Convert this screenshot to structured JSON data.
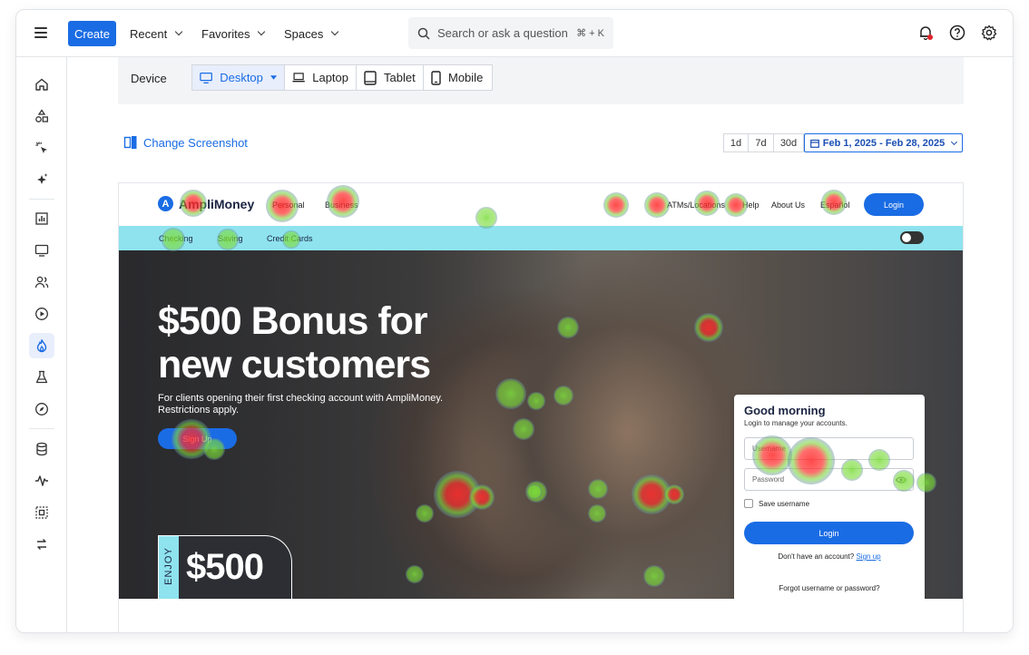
{
  "topbar": {
    "create_label": "Create",
    "recent_label": "Recent",
    "favorites_label": "Favorites",
    "spaces_label": "Spaces",
    "search_placeholder": "Search or ask a question",
    "search_shortcut": "⌘ + K"
  },
  "device": {
    "label": "Device",
    "options": [
      "Desktop",
      "Laptop",
      "Tablet",
      "Mobile"
    ],
    "selected": "Desktop"
  },
  "toolbar": {
    "change_screenshot": "Change Screenshot",
    "ranges": [
      "1d",
      "7d",
      "30d"
    ],
    "date_range": "Feb 1, 2025 - Feb 28, 2025"
  },
  "site": {
    "logo_letter": "A",
    "brand": "AmpliMoney",
    "nav": [
      "Personal",
      "Business",
      "ATMs/Locations",
      "Help",
      "About Us",
      "Español"
    ],
    "login": "Login",
    "sub_nav": [
      "Checking",
      "Saving",
      "Credit Cards"
    ],
    "hero_title": "$500 Bonus for new customers",
    "hero_sub": "For clients opening their first checking account with AmpliMoney. Restrictions apply.",
    "hero_cta": "Sign Up",
    "enjoy": "ENJOY",
    "enjoy_amount": "$500",
    "card": {
      "title": "Good morning",
      "subtitle": "Login to manage your accounts.",
      "username_placeholder": "Username",
      "password_placeholder": "Password",
      "save_username": "Save username",
      "login": "Login",
      "no_account": "Don't have an account?",
      "sign_up": "Sign up",
      "forgot": "Forgot username or password?"
    }
  },
  "colors": {
    "accent": "#1a6ce4",
    "sub_nav": "#8ee3ee",
    "heat_hot": "#ff2a2a",
    "heat_warm": "#7cdc3c",
    "heat_cool": "#4a4de0"
  }
}
